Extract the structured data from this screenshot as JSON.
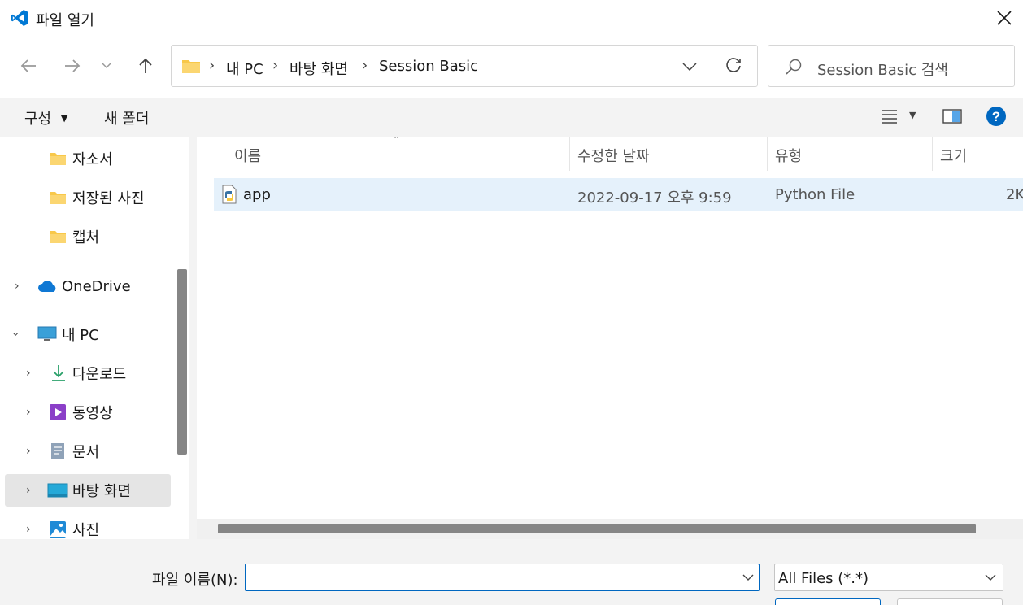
{
  "window": {
    "title": "파일 열기"
  },
  "address": {
    "items": [
      "내 PC",
      "바탕 화면",
      "Session Basic"
    ]
  },
  "search": {
    "placeholder": "Session Basic 검색"
  },
  "commandbar": {
    "organize": "구성",
    "new_folder": "새 폴더"
  },
  "navpane": {
    "items": [
      {
        "label": "자소서",
        "icon": "folder-icon"
      },
      {
        "label": "저장된 사진",
        "icon": "folder-icon"
      },
      {
        "label": "캡처",
        "icon": "folder-icon"
      },
      {
        "label": "OneDrive",
        "icon": "onedrive-cloud-icon"
      },
      {
        "label": "내 PC",
        "icon": "monitor-icon"
      },
      {
        "label": "다운로드",
        "icon": "download-icon"
      },
      {
        "label": "동영상",
        "icon": "video-icon"
      },
      {
        "label": "문서",
        "icon": "document-icon"
      },
      {
        "label": "바탕 화면",
        "icon": "desktop-icon"
      },
      {
        "label": "사진",
        "icon": "pictures-icon"
      }
    ]
  },
  "filelist": {
    "columns": [
      "이름",
      "수정한 날짜",
      "유형",
      "크기"
    ],
    "rows": [
      {
        "name": "app",
        "modified": "2022-09-17 오후 9:59",
        "type": "Python File",
        "size": "2K",
        "icon": "python-file-icon"
      }
    ]
  },
  "bottom": {
    "filename_label": "파일 이름(N):",
    "filename_value": "",
    "filetype_value": "All Files (*.*)"
  },
  "colors": {
    "accent": "#0067c0",
    "selection": "#e5f1fb",
    "folder": "#f8c84a"
  }
}
